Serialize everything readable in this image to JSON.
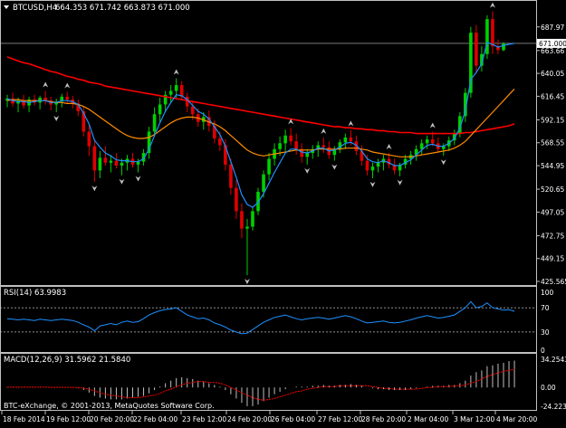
{
  "header": {
    "symbol_label": "BTCUSD,H4",
    "ohlc_label": "664.353 671.742 663.873 671.000"
  },
  "rsi_panel": {
    "label": "RSI(14) 63.9983"
  },
  "macd_panel": {
    "label": "MACD(12,26,9) 31.5962 21.5840"
  },
  "footer": {
    "copyright": "BTC-eXchange, © 2001-2013, MetaQuotes Software Corp."
  },
  "colors": {
    "background": "#000000",
    "grid_text": "#ffffff",
    "bull_candle": "#00d000",
    "bear_candle": "#e00000",
    "ma_long": "#ff0000",
    "ma_short": "#ff8c00",
    "ma_fast": "#1e90ff",
    "fractal": "#c0c0c0",
    "rsi_line": "#1e90ff",
    "macd_hist": "#c0c0c0",
    "macd_signal": "#ff0000"
  },
  "chart_data": [
    {
      "type": "candlestick",
      "timeframe": "H4",
      "y_ticks": [
        687.97,
        663.66,
        640.05,
        616.45,
        592.15,
        568.55,
        544.95,
        520.65,
        497.05,
        472.75,
        449.15,
        425.565
      ],
      "ylim": [
        425.565,
        712
      ],
      "current_price": 671.0,
      "current_price_label": "671.000",
      "x_ticks": [
        "18 Feb 2014",
        "19 Feb 12:00",
        "20 Feb 20:00",
        "22 Feb 04:00",
        "23 Feb 12:00",
        "24 Feb 20:00",
        "26 Feb 04:00",
        "27 Feb 12:00",
        "28 Feb 20:00",
        "2 Mar 04:00",
        "3 Mar 12:00",
        "4 Mar 20:00"
      ],
      "candles": [
        [
          612,
          618,
          605,
          614
        ],
        [
          614,
          620,
          606,
          609
        ],
        [
          609,
          615,
          600,
          612
        ],
        [
          612,
          618,
          604,
          607
        ],
        [
          607,
          616,
          600,
          613
        ],
        [
          613,
          618,
          607,
          610
        ],
        [
          610,
          617,
          603,
          615
        ],
        [
          615,
          622,
          608,
          612
        ],
        [
          612,
          616,
          602,
          608
        ],
        [
          608,
          614,
          600,
          611
        ],
        [
          611,
          619,
          605,
          616
        ],
        [
          616,
          621,
          609,
          613
        ],
        [
          613,
          617,
          604,
          609
        ],
        [
          609,
          613,
          596,
          601
        ],
        [
          601,
          606,
          575,
          580
        ],
        [
          580,
          588,
          555,
          565
        ],
        [
          565,
          572,
          528,
          540
        ],
        [
          540,
          560,
          532,
          553
        ],
        [
          553,
          565,
          545,
          548
        ],
        [
          548,
          556,
          538,
          550
        ],
        [
          550,
          558,
          542,
          545
        ],
        [
          545,
          552,
          535,
          548
        ],
        [
          548,
          556,
          540,
          552
        ],
        [
          552,
          558,
          543,
          546
        ],
        [
          546,
          552,
          538,
          549
        ],
        [
          549,
          562,
          545,
          558
        ],
        [
          558,
          585,
          552,
          580
        ],
        [
          580,
          605,
          575,
          598
        ],
        [
          598,
          615,
          590,
          608
        ],
        [
          608,
          622,
          600,
          618
        ],
        [
          618,
          628,
          610,
          622
        ],
        [
          622,
          635,
          615,
          628
        ],
        [
          628,
          632,
          612,
          616
        ],
        [
          616,
          620,
          600,
          606
        ],
        [
          606,
          612,
          592,
          598
        ],
        [
          598,
          604,
          585,
          590
        ],
        [
          590,
          600,
          582,
          595
        ],
        [
          595,
          602,
          580,
          586
        ],
        [
          586,
          592,
          568,
          573
        ],
        [
          573,
          580,
          560,
          566
        ],
        [
          566,
          572,
          540,
          546
        ],
        [
          546,
          552,
          515,
          522
        ],
        [
          522,
          530,
          490,
          498
        ],
        [
          498,
          506,
          470,
          480
        ],
        [
          480,
          490,
          432,
          482
        ],
        [
          482,
          502,
          478,
          498
        ],
        [
          498,
          522,
          494,
          518
        ],
        [
          518,
          540,
          512,
          536
        ],
        [
          536,
          558,
          530,
          552
        ],
        [
          552,
          568,
          545,
          562
        ],
        [
          562,
          575,
          555,
          568
        ],
        [
          568,
          582,
          560,
          576
        ],
        [
          576,
          584,
          566,
          570
        ],
        [
          570,
          578,
          556,
          562
        ],
        [
          562,
          568,
          548,
          554
        ],
        [
          554,
          562,
          546,
          558
        ],
        [
          558,
          566,
          552,
          562
        ],
        [
          562,
          570,
          554,
          566
        ],
        [
          566,
          574,
          558,
          564
        ],
        [
          564,
          570,
          552,
          556
        ],
        [
          556,
          565,
          550,
          562
        ],
        [
          562,
          572,
          558,
          569
        ],
        [
          569,
          578,
          562,
          574
        ],
        [
          574,
          582,
          566,
          570
        ],
        [
          570,
          576,
          556,
          560
        ],
        [
          560,
          566,
          545,
          550
        ],
        [
          550,
          556,
          535,
          540
        ],
        [
          540,
          548,
          532,
          544
        ],
        [
          544,
          552,
          538,
          548
        ],
        [
          548,
          556,
          540,
          552
        ],
        [
          552,
          558,
          542,
          546
        ],
        [
          546,
          552,
          536,
          540
        ],
        [
          540,
          548,
          534,
          546
        ],
        [
          546,
          556,
          542,
          552
        ],
        [
          552,
          560,
          546,
          556
        ],
        [
          556,
          566,
          550,
          562
        ],
        [
          562,
          572,
          556,
          568
        ],
        [
          568,
          576,
          562,
          572
        ],
        [
          572,
          580,
          565,
          568
        ],
        [
          568,
          574,
          558,
          562
        ],
        [
          562,
          568,
          555,
          565
        ],
        [
          565,
          575,
          560,
          571
        ],
        [
          571,
          582,
          566,
          578
        ],
        [
          578,
          600,
          574,
          596
        ],
        [
          596,
          625,
          590,
          620
        ],
        [
          620,
          688,
          615,
          682
        ],
        [
          682,
          690,
          640,
          648
        ],
        [
          648,
          668,
          642,
          660
        ],
        [
          660,
          700,
          655,
          696
        ],
        [
          696,
          704,
          660,
          668
        ],
        [
          668,
          675,
          660,
          664
        ],
        [
          664,
          672,
          663,
          671
        ]
      ],
      "series": [
        {
          "name": "",
          "values": [
            657,
            655,
            653,
            651,
            650,
            648,
            646,
            644,
            642,
            641,
            639,
            637,
            636,
            634,
            633,
            631,
            630,
            629,
            627,
            626,
            625,
            624,
            623,
            622,
            621,
            620,
            619,
            618,
            617,
            616,
            615,
            614,
            613,
            612,
            611,
            610,
            609,
            608,
            607,
            606,
            605,
            604,
            603,
            602,
            601,
            600,
            599,
            598,
            597,
            596,
            595,
            594,
            593,
            592,
            591,
            590,
            589,
            588,
            587,
            586,
            585,
            585,
            584,
            584,
            583,
            583,
            582,
            582,
            581,
            581,
            580,
            580,
            579,
            579,
            579,
            578,
            578,
            578,
            578,
            578,
            578,
            578,
            578,
            578,
            579,
            579,
            580,
            581,
            582,
            583,
            584,
            585,
            586,
            588
          ]
        },
        {
          "name": "",
          "values": [
            612,
            613,
            613,
            612,
            612,
            612,
            612,
            612,
            611,
            610,
            610,
            609,
            609,
            608,
            606,
            603,
            599,
            595,
            591,
            587,
            583,
            579,
            576,
            574,
            573,
            573,
            574,
            577,
            581,
            585,
            589,
            592,
            594,
            595,
            595,
            594,
            592,
            590,
            588,
            585,
            581,
            576,
            571,
            566,
            561,
            558,
            556,
            555,
            556,
            557,
            558,
            559,
            560,
            561,
            561,
            561,
            561,
            562,
            562,
            562,
            562,
            562,
            563,
            563,
            563,
            562,
            561,
            559,
            558,
            557,
            556,
            555,
            554,
            554,
            554,
            555,
            556,
            557,
            558,
            559,
            560,
            561,
            563,
            566,
            570,
            576,
            582,
            588,
            594,
            600,
            606,
            612,
            618,
            624
          ]
        },
        {
          "name": "",
          "values": [
            614,
            612,
            611,
            611,
            610,
            611,
            612,
            612,
            610,
            610,
            612,
            612,
            611,
            608,
            599,
            588,
            571,
            564,
            558,
            555,
            551,
            550,
            550,
            549,
            549,
            552,
            562,
            576,
            589,
            601,
            610,
            618,
            617,
            613,
            607,
            601,
            598,
            593,
            585,
            577,
            565,
            549,
            533,
            515,
            505,
            502,
            507,
            516,
            527,
            538,
            548,
            558,
            562,
            562,
            559,
            558,
            560,
            563,
            563,
            560,
            561,
            564,
            568,
            569,
            566,
            560,
            552,
            549,
            548,
            550,
            548,
            545,
            545,
            548,
            551,
            556,
            561,
            566,
            567,
            565,
            565,
            568,
            573,
            584,
            601,
            634,
            641,
            650,
            672,
            670,
            667,
            669,
            670,
            671
          ]
        }
      ]
    },
    {
      "type": "line",
      "title": "RSI(14) 63.9983",
      "y_ticks": [
        100,
        70,
        30,
        0
      ],
      "ylim": [
        0,
        100
      ],
      "levels": [
        70,
        30
      ],
      "series": [
        {
          "name": "",
          "values": [
            52,
            51,
            50,
            51,
            50,
            49,
            51,
            50,
            49,
            50,
            51,
            50,
            49,
            46,
            42,
            38,
            32,
            40,
            42,
            44,
            42,
            46,
            48,
            46,
            47,
            52,
            58,
            62,
            65,
            67,
            68,
            70,
            64,
            58,
            55,
            52,
            53,
            50,
            45,
            42,
            38,
            33,
            30,
            27,
            28,
            34,
            40,
            46,
            50,
            54,
            56,
            58,
            55,
            52,
            50,
            52,
            53,
            54,
            53,
            51,
            53,
            55,
            57,
            55,
            52,
            48,
            45,
            46,
            47,
            48,
            46,
            45,
            46,
            48,
            50,
            53,
            55,
            57,
            55,
            53,
            54,
            56,
            58,
            64,
            70,
            80,
            70,
            72,
            78,
            70,
            68,
            66,
            67,
            64
          ]
        }
      ]
    },
    {
      "type": "bar",
      "title": "MACD(12,26,9) 31.5962 21.5840",
      "y_ticks": [
        34.2543,
        0.0,
        -24.2237
      ],
      "ylim": [
        -24.2237,
        34.2543
      ],
      "series": [
        {
          "name": "",
          "values": [
            0.5,
            0.5,
            0.4,
            0.4,
            0.3,
            0.3,
            0.3,
            0.2,
            0.1,
            0.1,
            0.1,
            0,
            0,
            -1,
            -3,
            -6,
            -10,
            -12,
            -13,
            -14,
            -14,
            -14,
            -13,
            -12,
            -11,
            -10,
            -7,
            -3,
            1,
            5,
            8,
            11,
            12,
            11,
            10,
            8,
            7,
            5,
            3,
            1,
            -3,
            -8,
            -13,
            -18,
            -22,
            -22,
            -20,
            -16,
            -12,
            -8,
            -5,
            -2,
            0,
            1,
            1,
            1,
            2,
            2,
            3,
            2,
            2,
            3,
            3,
            4,
            3,
            2,
            0,
            -1,
            -2,
            -2,
            -3,
            -3,
            -3,
            -3,
            -2,
            -1,
            0,
            1,
            2,
            2,
            2,
            3,
            3,
            5,
            8,
            14,
            18,
            20,
            25,
            26,
            28,
            29,
            31,
            31.6
          ]
        },
        {
          "name": "",
          "values": [
            0.3,
            0.3,
            0.3,
            0.3,
            0.3,
            0.3,
            0.3,
            0.3,
            0.2,
            0.2,
            0.2,
            0.1,
            0.1,
            -0.2,
            -0.8,
            -2,
            -4,
            -6,
            -8,
            -9,
            -10,
            -11,
            -12,
            -12,
            -12,
            -11,
            -10,
            -9,
            -7,
            -4,
            -2,
            1,
            3,
            5,
            6,
            7,
            7,
            6,
            6,
            5,
            3,
            0,
            -3,
            -6,
            -9,
            -12,
            -14,
            -15,
            -14,
            -13,
            -11,
            -9,
            -7,
            -5,
            -4,
            -2,
            -1,
            0,
            1,
            1,
            1,
            2,
            2,
            2,
            2,
            2,
            2,
            1,
            0,
            -1,
            -1,
            -2,
            -2,
            -2,
            -2,
            -2,
            -1,
            0,
            0,
            1,
            1,
            1,
            2,
            2,
            3,
            5,
            7,
            10,
            13,
            15,
            17,
            19,
            20,
            21.58
          ]
        }
      ]
    }
  ]
}
